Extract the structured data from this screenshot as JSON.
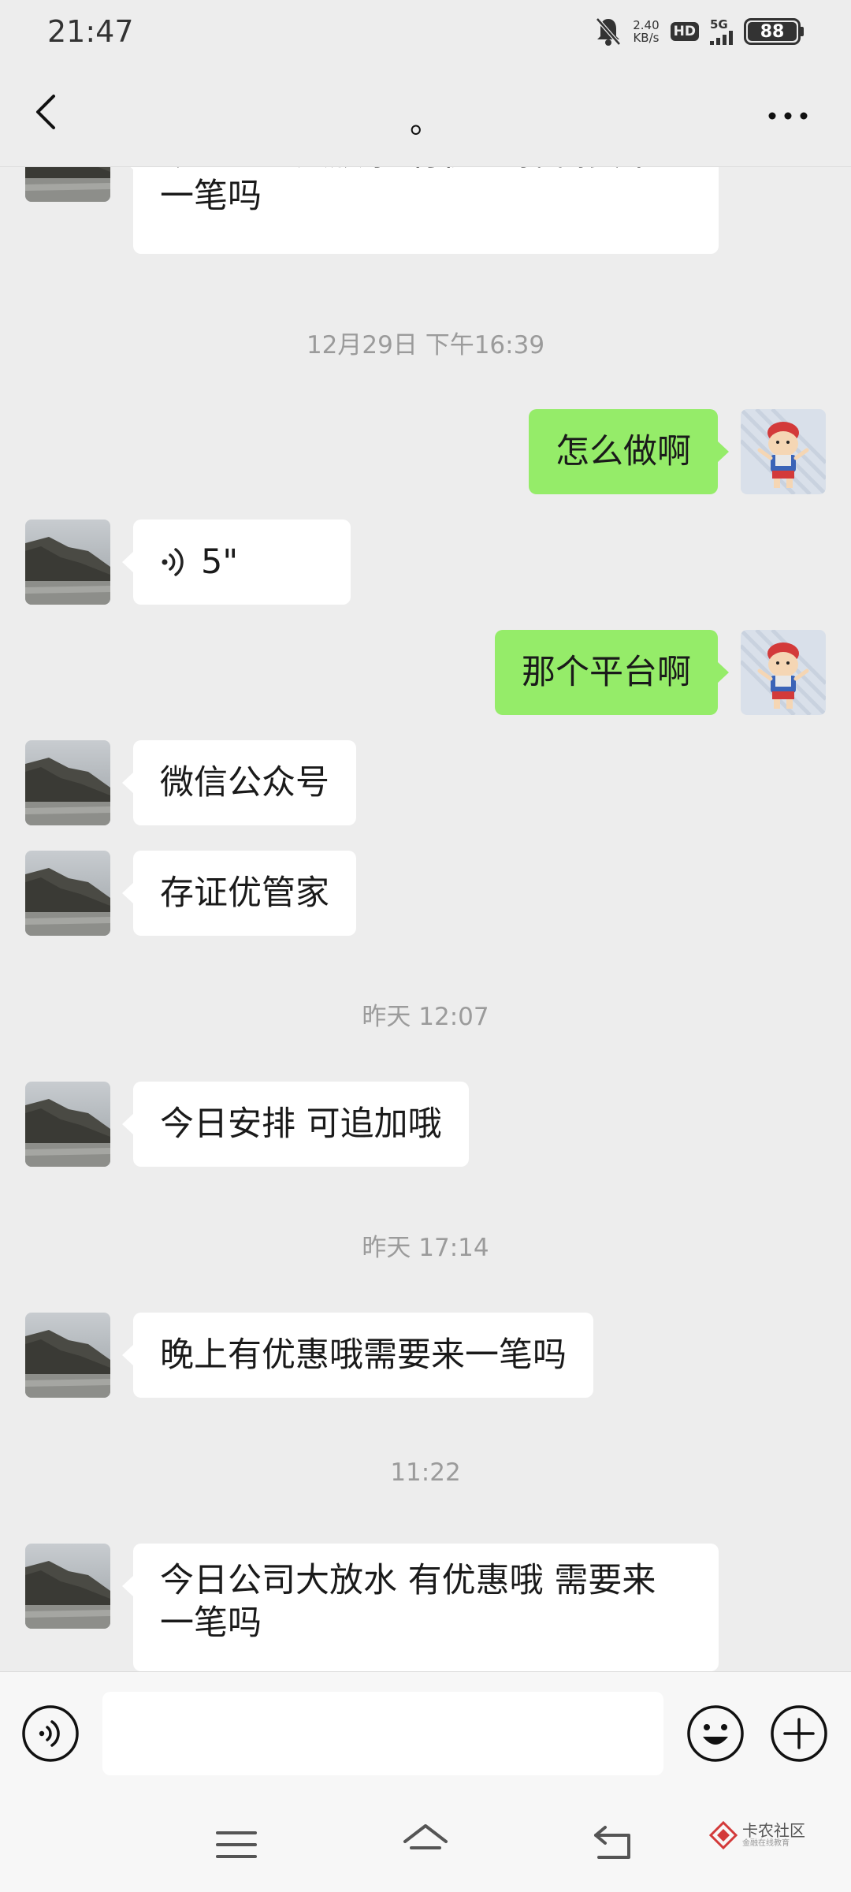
{
  "status_bar": {
    "time": "21:47",
    "net_speed_value": "2.40",
    "net_speed_unit": "KB/s",
    "hd": "HD",
    "signal": "5G",
    "battery": "88"
  },
  "header": {
    "title": "。"
  },
  "messages": [
    {
      "side": "left",
      "text_line1": "今日公司大放水 有优惠哦 需要来",
      "text_line2": "一笔吗"
    },
    {
      "timestamp": "12月29日 下午16:39"
    },
    {
      "side": "right",
      "text": "怎么做啊"
    },
    {
      "side": "left",
      "type": "voice",
      "duration": "5\""
    },
    {
      "side": "right",
      "text": "那个平台啊"
    },
    {
      "side": "left",
      "text": "微信公众号"
    },
    {
      "side": "left",
      "text": "存证优管家"
    },
    {
      "timestamp": "昨天 12:07"
    },
    {
      "side": "left",
      "text": "今日安排 可追加哦"
    },
    {
      "timestamp": "昨天 17:14"
    },
    {
      "side": "left",
      "text": "晚上有优惠哦需要来一笔吗"
    },
    {
      "timestamp": "11:22"
    },
    {
      "side": "left",
      "text_line1": "今日公司大放水 有优惠哦 需要来",
      "text_line2": "一笔吗"
    }
  ],
  "input_bar": {
    "placeholder": "",
    "voice_icon": "voice-icon",
    "emoji_icon": "smiley-icon",
    "plus_icon": "plus-icon"
  },
  "watermark": {
    "main": "卡农社区",
    "sub": "金融在线教育"
  },
  "colors": {
    "bubble_green": "#95ec69",
    "bubble_white": "#ffffff",
    "background": "#ededed"
  }
}
